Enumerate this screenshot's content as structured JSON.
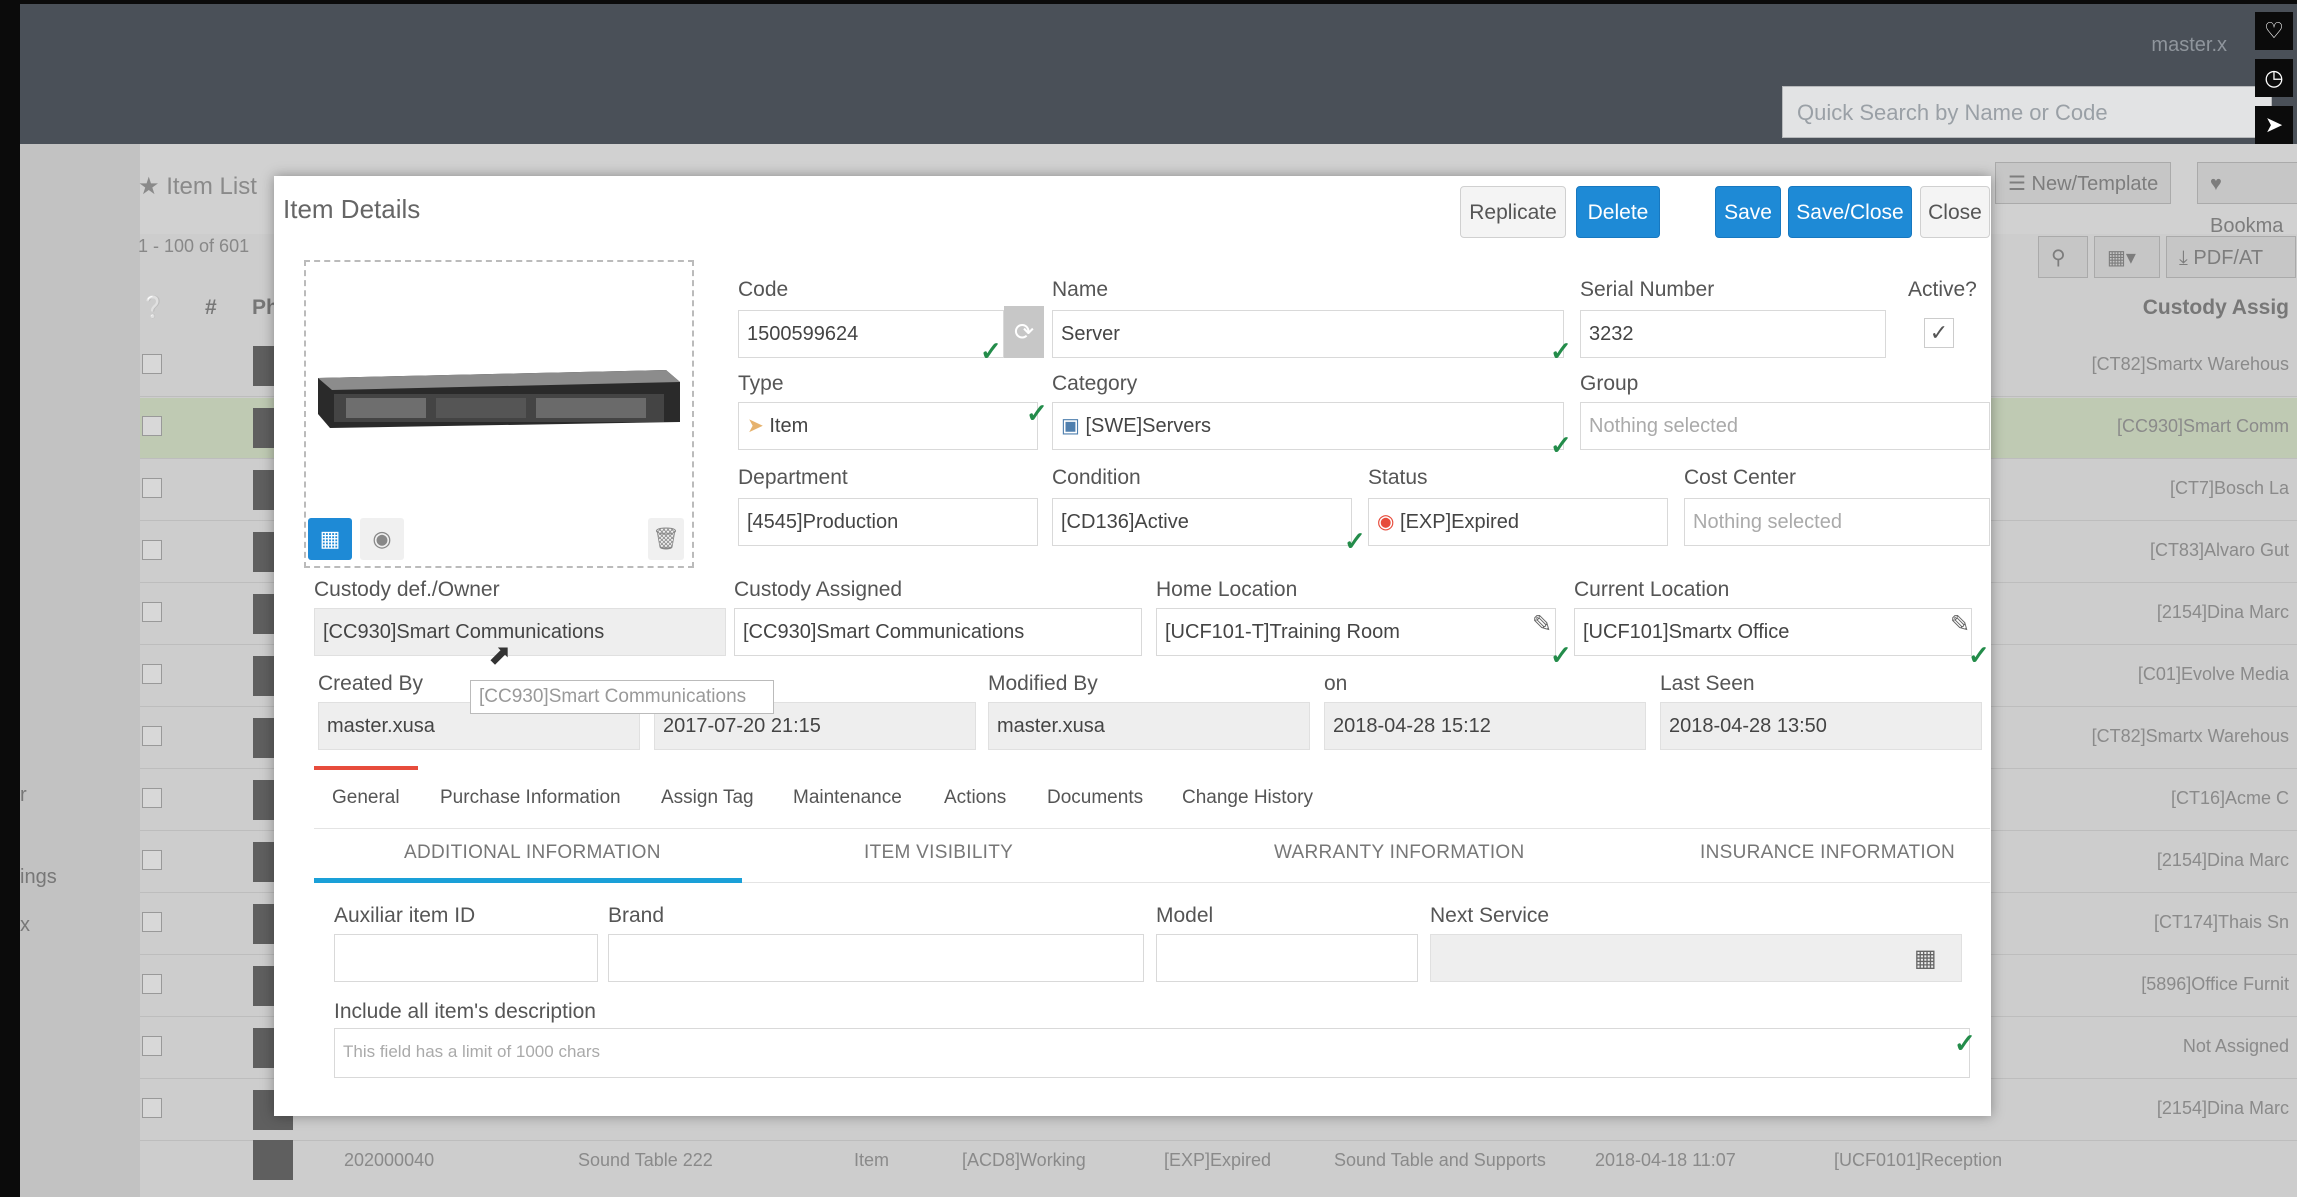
{
  "header": {
    "user": "master.x",
    "search_placeholder": "Quick Search by Name or Code",
    "side_icons": [
      "heart-icon",
      "clock-icon",
      "send-icon"
    ]
  },
  "background": {
    "list_title": "Item List",
    "record_count": "1 - 100 of 601",
    "toolbar": {
      "new_template": "New/Template",
      "bookmark": "Bookma",
      "pdf": "PDF/AT"
    },
    "columns": {
      "index": "#",
      "photo": "Pho",
      "custody": "Custody Assig"
    },
    "nav_fragments": [
      "r",
      "ings",
      "x"
    ],
    "rows": [
      {
        "custody": "[CT82]Smartx Warehous"
      },
      {
        "custody": "[CC930]Smart Comm",
        "highlighted": true
      },
      {
        "custody": "[CT7]Bosch La"
      },
      {
        "custody": "[CT83]Alvaro Gut"
      },
      {
        "custody": "[2154]Dina Marc"
      },
      {
        "custody": "[C01]Evolve Media"
      },
      {
        "custody": "[CT82]Smartx Warehous"
      },
      {
        "custody": "[CT16]Acme C"
      },
      {
        "custody": "[2154]Dina Marc"
      },
      {
        "custody": "[CT174]Thais Sn"
      },
      {
        "custody": "[5896]Office Furnit"
      },
      {
        "custody": "Not Assigned"
      },
      {
        "custody": "[2154]Dina Marc"
      }
    ],
    "last_row": {
      "code": "202000040",
      "name": "Sound Table 222",
      "type": "Item",
      "condition": "[ACD8]Working",
      "status": "[EXP]Expired",
      "category": "Sound Table and Supports",
      "date": "2018-04-18 11:07",
      "location": "[UCF0101]Reception"
    }
  },
  "modal": {
    "title": "Item Details",
    "buttons": {
      "replicate": "Replicate",
      "delete": "Delete",
      "save": "Save",
      "save_close": "Save/Close",
      "close": "Close"
    },
    "fields": {
      "code": {
        "label": "Code",
        "value": "1500599624"
      },
      "name": {
        "label": "Name",
        "value": "Server"
      },
      "serial": {
        "label": "Serial Number",
        "value": "3232"
      },
      "active": {
        "label": "Active?",
        "checked": true
      },
      "type": {
        "label": "Type",
        "value": "Item"
      },
      "category": {
        "label": "Category",
        "value": "[SWE]Servers"
      },
      "group": {
        "label": "Group",
        "placeholder": "Nothing selected"
      },
      "department": {
        "label": "Department",
        "value": "[4545]Production"
      },
      "condition": {
        "label": "Condition",
        "value": "[CD136]Active"
      },
      "status": {
        "label": "Status",
        "value": "[EXP]Expired"
      },
      "cost_center": {
        "label": "Cost Center",
        "placeholder": "Nothing selected"
      },
      "custody_owner": {
        "label": "Custody def./Owner",
        "value": "[CC930]Smart Communications"
      },
      "custody_assigned": {
        "label": "Custody Assigned",
        "value": "[CC930]Smart Communications"
      },
      "home_location": {
        "label": "Home Location",
        "value": "[UCF101-T]Training Room"
      },
      "current_location": {
        "label": "Current Location",
        "value": "[UCF101]Smartx Office"
      },
      "created_by": {
        "label": "Created By",
        "value": "master.xusa"
      },
      "created_on": {
        "value": "2017-07-20 21:15"
      },
      "modified_by": {
        "label": "Modified By",
        "value": "master.xusa"
      },
      "modified_on": {
        "label": "on",
        "value": "2018-04-28 15:12"
      },
      "last_seen": {
        "label": "Last Seen",
        "value": "2018-04-28 13:50"
      }
    },
    "tooltip": "[CC930]Smart Communications",
    "tabs": [
      "General",
      "Purchase Information",
      "Assign Tag",
      "Maintenance",
      "Actions",
      "Documents",
      "Change History"
    ],
    "active_tab": "General",
    "subtabs": [
      "ADDITIONAL INFORMATION",
      "ITEM VISIBILITY",
      "WARRANTY INFORMATION",
      "INSURANCE INFORMATION"
    ],
    "active_subtab": "ADDITIONAL INFORMATION",
    "additional": {
      "aux_id": {
        "label": "Auxiliar item ID"
      },
      "brand": {
        "label": "Brand"
      },
      "model": {
        "label": "Model"
      },
      "next_service": {
        "label": "Next Service"
      },
      "description": {
        "label": "Include all item's description",
        "placeholder": "This field has a limit of 1000 chars"
      }
    }
  },
  "colors": {
    "primary": "#1e8ad6",
    "check": "#238c4a",
    "active_tab": "#e74c3c",
    "active_subtab": "#1aa0d8"
  }
}
